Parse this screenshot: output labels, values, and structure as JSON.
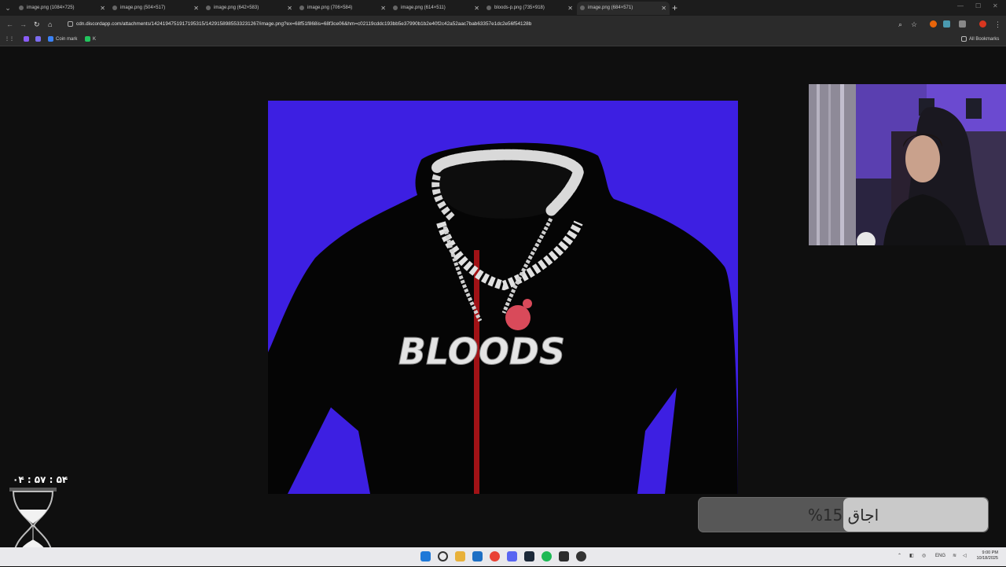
{
  "browser": {
    "tabs": [
      {
        "title": "image.png (1084×725)",
        "active": false
      },
      {
        "title": "image.png (504×517)",
        "active": false
      },
      {
        "title": "image.png (642×583)",
        "active": false
      },
      {
        "title": "image.png (706×584)",
        "active": false
      },
      {
        "title": "image.png (614×511)",
        "active": false
      },
      {
        "title": "bloods-p.png (735×918)",
        "active": false
      },
      {
        "title": "image.png (684×571)",
        "active": true
      }
    ],
    "url": "cdn.discordapp.com/attachments/1424194751917195315/1429158985533231267/image.png?ex=68f51f868is=68f3ce06&hm=c02119cddc193bb5e37990b1b2e40f2c42a52aac7bab63357e1dc2e56f54128b",
    "bookmarks": [
      {
        "label": "",
        "color": "#8a5cf6"
      },
      {
        "label": "",
        "color": "#7c6cf0"
      },
      {
        "label": "Coin mark",
        "color": "#3b82f6"
      },
      {
        "label": "K",
        "color": "#22c55e"
      }
    ],
    "all_bookmarks_label": "All Bookmarks"
  },
  "image": {
    "caption_text": "BLOODS",
    "background_color": "#3d1fe2"
  },
  "overlay": {
    "timer": "۰۴ : ۵۷ : ۵۴",
    "progress_text": "اجاق 15%",
    "progress_value": 0.5
  },
  "taskbar": {
    "language": "ENG",
    "time": "9:00 PM",
    "date": "10/18/2025"
  }
}
